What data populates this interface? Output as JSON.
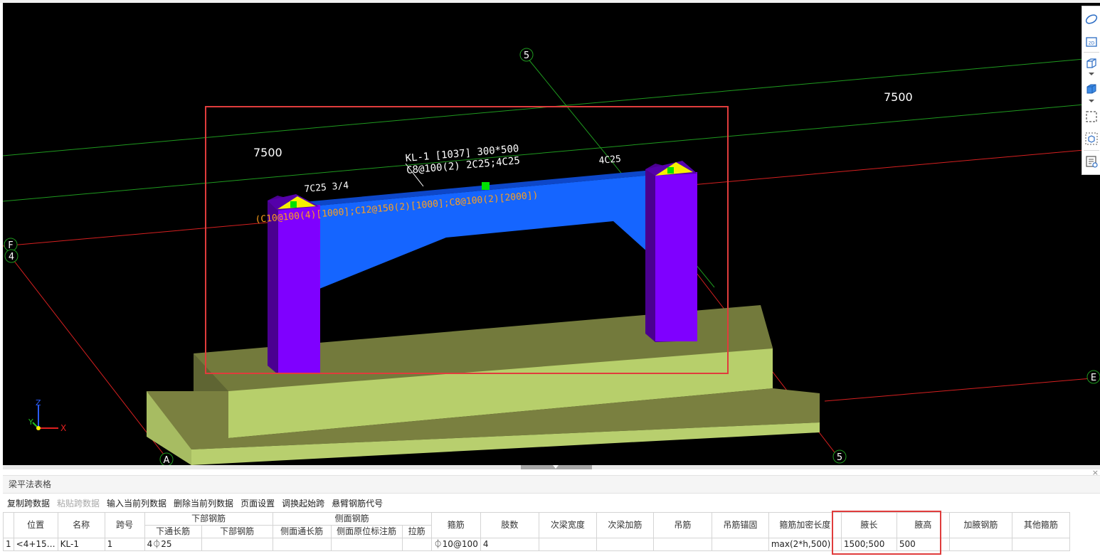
{
  "viewport": {
    "labels": {
      "dim_left": "7500",
      "dim_right": "7500",
      "axis_5_top": "5",
      "axis_5_bottom": "5",
      "axis_f": "F",
      "axis_4": "4",
      "axis_e": "E",
      "axis_a": "A",
      "beam_line1": "KL-1 [1037] 300*500",
      "beam_line2": "C8@100(2) 2C25;4C25",
      "beam_right": "4C25",
      "beam_bottom": "7C25 3/4",
      "beam_haunch": "(C10@100(4)[1000];C12@150(2)[1000];C8@100(2)[2000])",
      "coord_x": "X",
      "coord_y": "Y",
      "coord_z": "Z"
    },
    "colors": {
      "background": "#000000",
      "beam": "#1565ff",
      "column": "#7f00ff",
      "foundation_top": "#7a8040",
      "foundation_side": "#b8cf6e",
      "highlight": "#e03c3c",
      "grid_green": "#1f9a1f",
      "grid_red": "#d62020",
      "annotation": "#ff9f1a"
    }
  },
  "toolbar_right": {
    "icons": [
      "orbit-icon",
      "view-2d-icon",
      "view-3d-box-icon",
      "dropdown-icon",
      "solid-cube-icon",
      "dropdown-icon",
      "select-region-icon",
      "view-object-icon",
      "properties-view-icon"
    ],
    "view_2d_label": "2D"
  },
  "panel": {
    "title": "梁平法表格",
    "close": "×",
    "actions": [
      {
        "label": "复制跨数据",
        "enabled": true
      },
      {
        "label": "粘贴跨数据",
        "enabled": false
      },
      {
        "label": "输入当前列数据",
        "enabled": true
      },
      {
        "label": "删除当前列数据",
        "enabled": true
      },
      {
        "label": "页面设置",
        "enabled": true
      },
      {
        "label": "调换起始跨",
        "enabled": true
      },
      {
        "label": "悬臂钢筋代号",
        "enabled": true
      }
    ],
    "table": {
      "group_headers": {
        "bottom_rebar": "下部钢筋",
        "side_rebar": "侧面钢筋"
      },
      "columns": {
        "position": "位置",
        "name": "名称",
        "span": "跨号",
        "bottom_through": "下通长筋",
        "bottom_rebar": "下部钢筋",
        "side_through": "侧面通长筋",
        "side_original": "侧面原位标注筋",
        "tie": "拉筋",
        "stirrup": "箍筋",
        "legs": "肢数",
        "sec_beam_width": "次梁宽度",
        "sec_beam_add": "次梁加筋",
        "hanger": "吊筋",
        "hanger_anchor": "吊筋锚固",
        "stirrup_dense": "箍筋加密长度",
        "haunch_length": "腋长",
        "haunch_height": "腋高",
        "haunch_rebar": "加腋钢筋",
        "other_stirrup": "其他箍筋"
      },
      "rows": [
        {
          "index": "1",
          "position": "<4+15…",
          "name": "KL-1",
          "span": "1",
          "bottom_through": "4⏀25",
          "bottom_rebar": "",
          "side_through": "",
          "side_original": "",
          "tie": "",
          "stirrup": "⏀10@100",
          "legs": "4",
          "sec_beam_width": "",
          "sec_beam_add": "",
          "hanger": "",
          "hanger_anchor": "",
          "stirrup_dense": "max(2*h,500)",
          "haunch_length": "1500;500",
          "haunch_height": "500",
          "haunch_rebar": "",
          "other_stirrup": ""
        }
      ]
    }
  }
}
